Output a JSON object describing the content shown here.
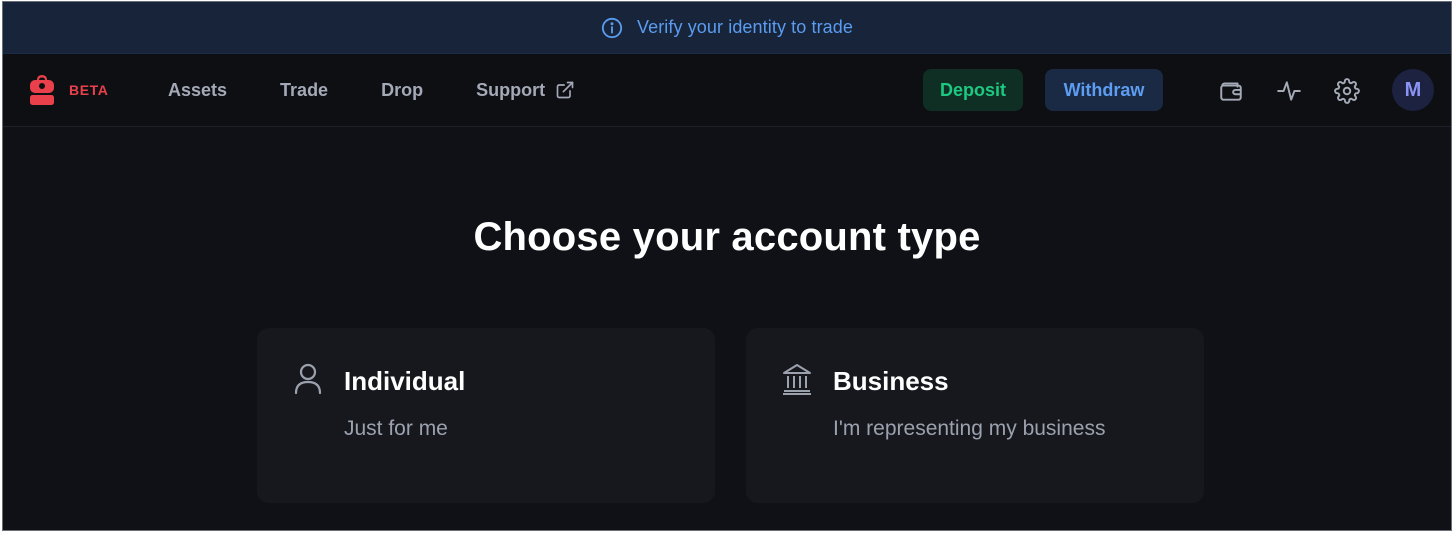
{
  "banner": {
    "icon": "info-icon",
    "text": "Verify your identity to trade"
  },
  "navbar": {
    "logo_icon": "backpack-icon",
    "beta_label": "BETA",
    "links": [
      {
        "label": "Assets"
      },
      {
        "label": "Trade"
      },
      {
        "label": "Drop"
      },
      {
        "label": "Support",
        "icon": "external-link-icon"
      }
    ],
    "deposit_label": "Deposit",
    "withdraw_label": "Withdraw",
    "icons": [
      "wallet-icon",
      "activity-icon",
      "gear-icon"
    ],
    "avatar_initial": "M"
  },
  "main": {
    "title": "Choose your account type",
    "cards": [
      {
        "title": "Individual",
        "subtitle": "Just for me",
        "icon": "user-icon"
      },
      {
        "title": "Business",
        "subtitle": "I'm representing my business",
        "icon": "bank-icon"
      }
    ]
  },
  "colors": {
    "background": "#0f1116",
    "banner_bg": "#18243a",
    "banner_text": "#5a9cf0",
    "brand_red": "#e9404b",
    "deposit_bg": "#0f2e24",
    "deposit_text": "#1dc880",
    "withdraw_bg": "#1b2a44",
    "withdraw_text": "#5c9df2",
    "card_bg": "#16181e",
    "avatar_bg": "#1d2240",
    "avatar_text": "#8b93f5"
  }
}
